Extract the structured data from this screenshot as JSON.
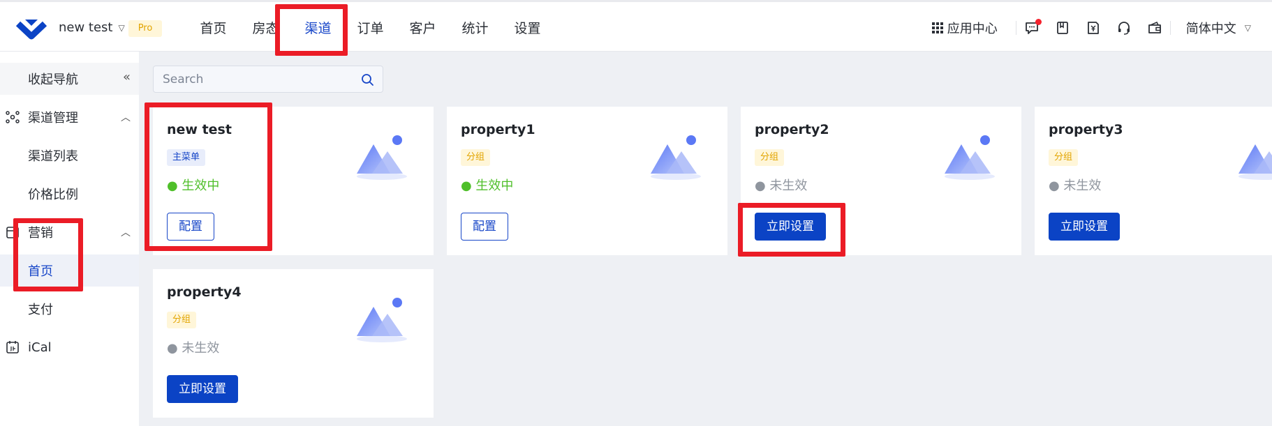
{
  "header": {
    "account_name": "new test",
    "pro_badge": "Pro",
    "nav": [
      "首页",
      "房态",
      "渠道",
      "订单",
      "客户",
      "统计",
      "设置"
    ],
    "active_nav": "渠道",
    "app_center": "应用中心",
    "language": "简体中文",
    "icons": [
      "message-icon",
      "book-icon",
      "invoice-icon",
      "headset-icon",
      "wallet-icon"
    ]
  },
  "sidebar": {
    "collapse_label": "收起导航",
    "channel_mgmt": "渠道管理",
    "channel_list": "渠道列表",
    "price_ratio": "价格比例",
    "marketing": "营销",
    "home": "首页",
    "payment": "支付",
    "ical": "iCal"
  },
  "search": {
    "placeholder": "Search"
  },
  "cards": [
    {
      "name": "new test",
      "tag": "主菜单",
      "status": "● 生效中",
      "button": "配置"
    },
    {
      "name": "property1",
      "tag": "分组",
      "status": "● 生效中",
      "button": "配置"
    },
    {
      "name": "property2",
      "tag": "分组",
      "status": "● 未生效",
      "button": "立即设置"
    },
    {
      "name": "property3",
      "tag": "分组",
      "status": "● 未生效",
      "button": "立即设置"
    },
    {
      "name": "property4",
      "tag": "分组",
      "status": "● 未生效",
      "button": "立即设置"
    }
  ],
  "colors": {
    "primary": "#0b43c5",
    "active_text": "#1746c8",
    "highlight": "#eb1c26",
    "status_on": "#4fbf2a"
  }
}
